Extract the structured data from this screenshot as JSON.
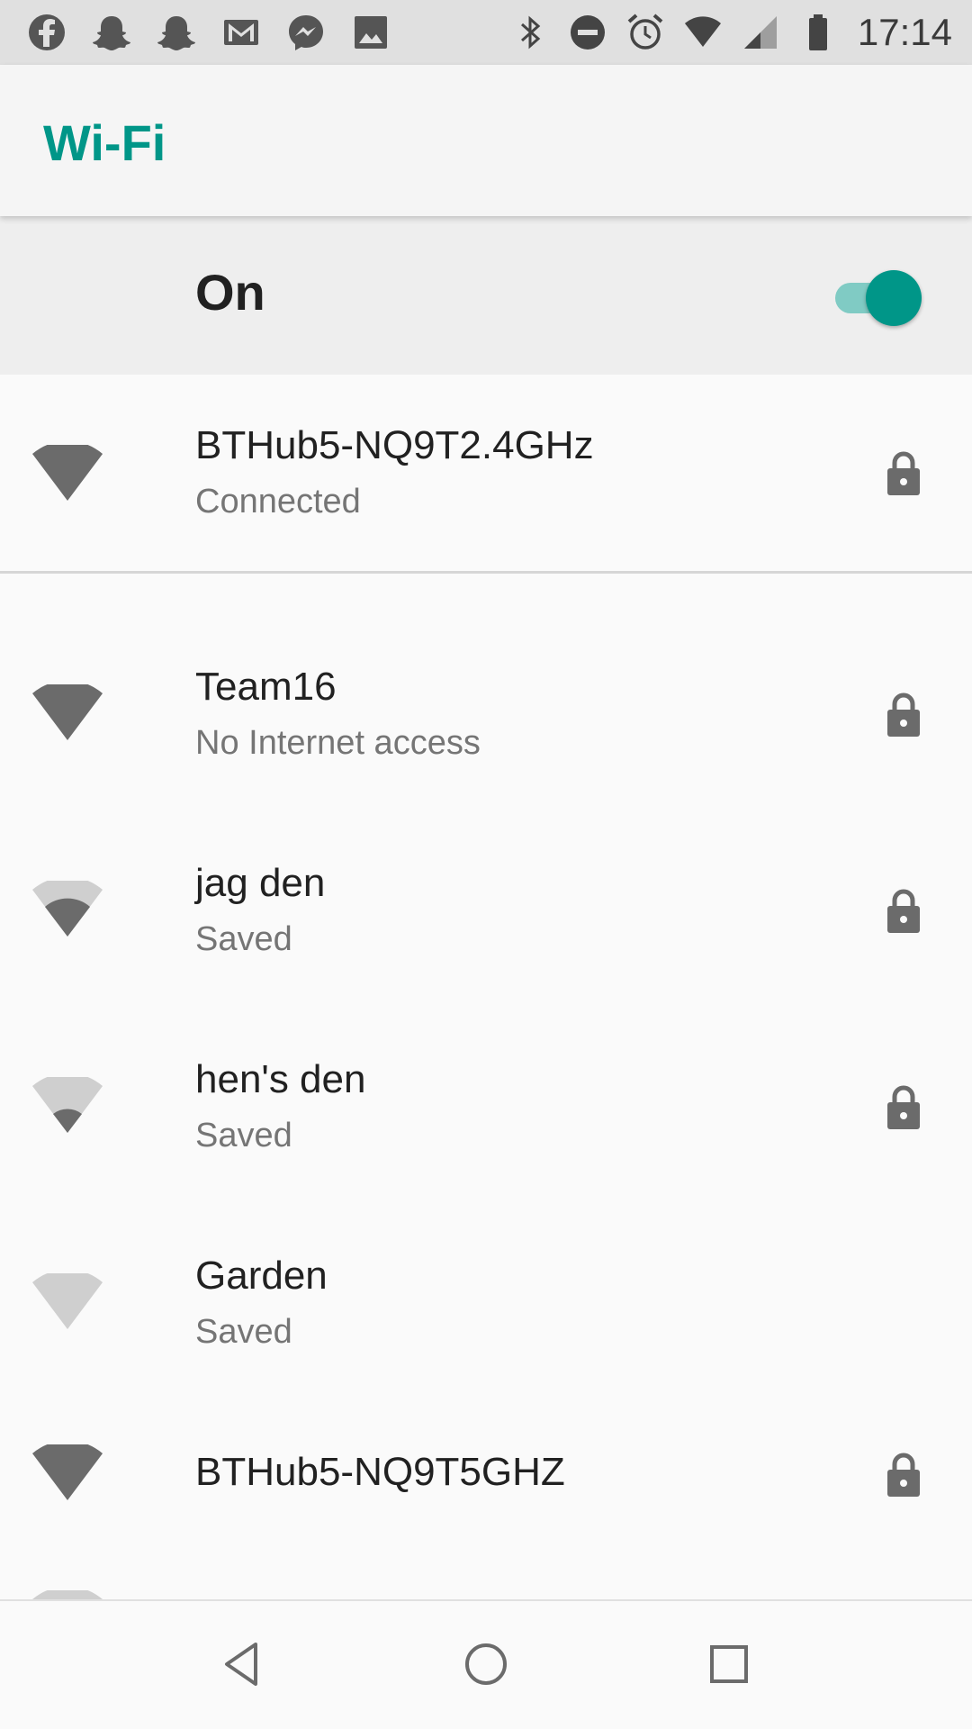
{
  "status_bar": {
    "time": "17:14",
    "notification_icons": [
      "facebook-icon",
      "snapchat-icon",
      "snapchat-icon",
      "gmail-icon",
      "messenger-icon",
      "image-icon"
    ],
    "system_icons": [
      "bluetooth-icon",
      "do-not-disturb-icon",
      "alarm-icon",
      "wifi-signal-icon",
      "cell-signal-icon",
      "battery-icon"
    ]
  },
  "app_bar": {
    "title": "Wi-Fi"
  },
  "master_switch": {
    "label": "On",
    "enabled": true
  },
  "networks": [
    {
      "name": "BTHub5-NQ9T2.4GHz",
      "status": "Connected",
      "signal_level": 4,
      "secured": true
    },
    {
      "name": "Team16",
      "status": "No Internet access",
      "signal_level": 4,
      "secured": true
    },
    {
      "name": "jag den",
      "status": "Saved",
      "signal_level": 2,
      "secured": true
    },
    {
      "name": "hen's den",
      "status": "Saved",
      "signal_level": 1,
      "secured": true
    },
    {
      "name": "Garden",
      "status": "Saved",
      "signal_level": 0,
      "secured": false
    },
    {
      "name": "BTHub5-NQ9T5GHZ",
      "status": "",
      "signal_level": 4,
      "secured": true
    }
  ],
  "navigation": {
    "buttons": [
      "back-icon",
      "home-icon",
      "recents-icon"
    ]
  },
  "colors": {
    "accent": "#009688",
    "accent_light": "#80cbc4",
    "status_bar": "#e0e0e0",
    "icon_dark": "#6b6b6b",
    "icon_light": "#cfcfcf"
  }
}
